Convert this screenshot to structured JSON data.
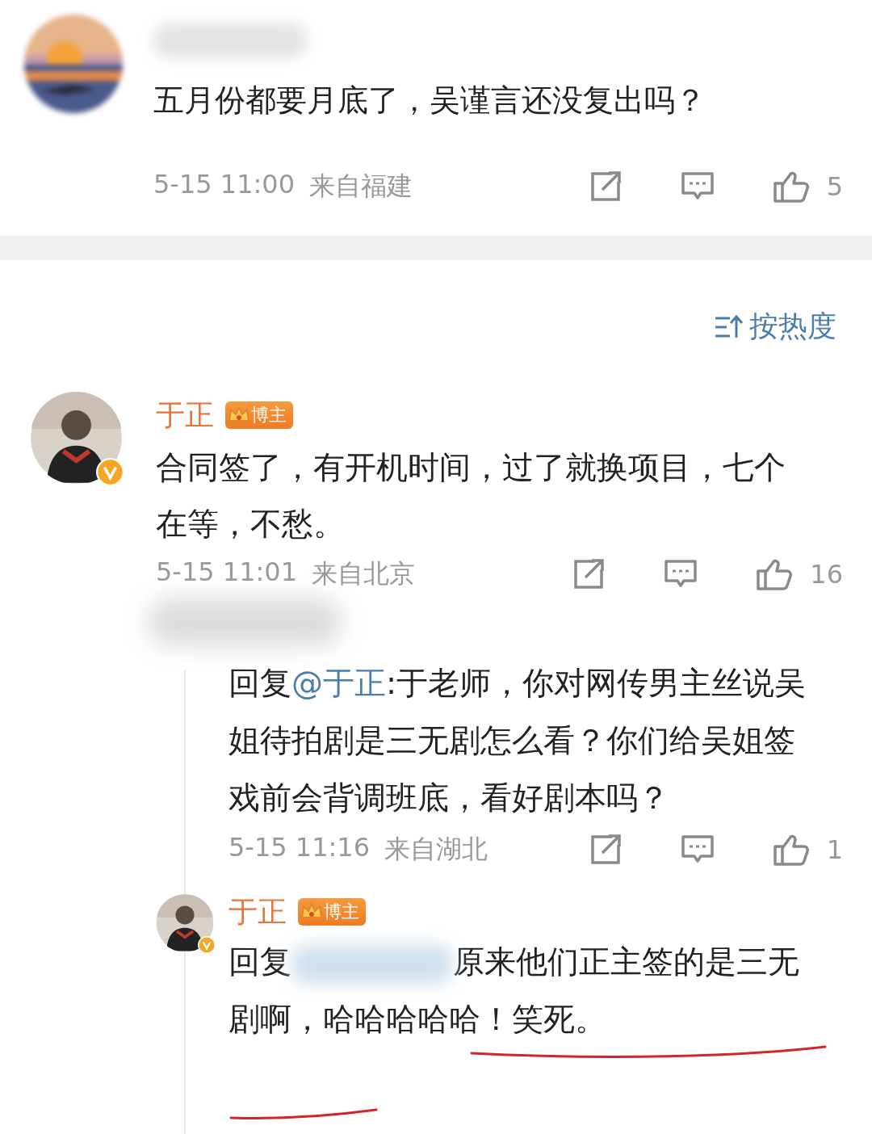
{
  "first_comment": {
    "name_hidden": true,
    "text": "五月份都要月底了，吴谨言还没复出吗？",
    "time": "5-15 11:00",
    "location": "来自福建",
    "likes": "5"
  },
  "sort": {
    "label": "按热度"
  },
  "main_comment": {
    "author": {
      "name": "于正",
      "badge": "博主",
      "verified": true
    },
    "text": "合同签了，有开机时间，过了就换项目，七个在等，不愁。",
    "time": "5-15 11:01",
    "location": "来自北京",
    "likes": "16",
    "replies": [
      {
        "author": {
          "name_hidden": true
        },
        "prefix": "回复",
        "mention": "@于正",
        "mention_hidden": false,
        "text": ":于老师，你对网传男主丝说吴姐待拍剧是三无剧怎么看？你们给吴姐签戏前会背调班底，看好剧本吗？",
        "time": "5-15 11:16",
        "location": "来自湖北",
        "likes": "1"
      },
      {
        "author": {
          "name_hidden": false,
          "name": "于正",
          "badge": "博主",
          "verified": true
        },
        "prefix": "回复",
        "mention_hidden": true,
        "text": "原来他们正主签的是三无剧啊，哈哈哈哈哈！笑死。"
      }
    ]
  }
}
